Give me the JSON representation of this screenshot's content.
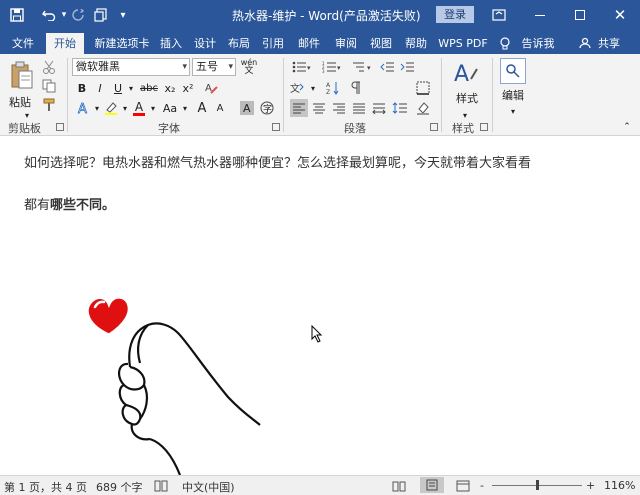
{
  "window": {
    "title": "热水器-维护  -  Word(产品激活失败)",
    "login_label": "登录",
    "minimize_icon": "minimize-icon",
    "restore_icon": "restore-icon",
    "close_icon": "close-icon"
  },
  "quick_access": [
    "save-icon",
    "undo-icon",
    "redo-icon",
    "touch-mode-icon",
    "customize-icon"
  ],
  "tabs": [
    {
      "label": "文件"
    },
    {
      "label": "开始"
    },
    {
      "label": "新建选项卡"
    },
    {
      "label": "插入"
    },
    {
      "label": "设计"
    },
    {
      "label": "布局"
    },
    {
      "label": "引用"
    },
    {
      "label": "邮件"
    },
    {
      "label": "审阅"
    },
    {
      "label": "视图"
    },
    {
      "label": "帮助"
    },
    {
      "label": "WPS PDF"
    }
  ],
  "tell_me": "告诉我",
  "share": "共享",
  "ribbon": {
    "clipboard": {
      "paste_label": "粘贴",
      "group_label": "剪贴板"
    },
    "font": {
      "font_name": "微软雅黑",
      "font_size": "五号",
      "wen_label": "wén",
      "bold": "B",
      "italic": "I",
      "underline": "U",
      "strike": "abc",
      "sub": "x₂",
      "sup": "x²",
      "aa_label": "Aa",
      "grow": "A",
      "shrink": "A",
      "group_label": "字体"
    },
    "paragraph": {
      "group_label": "段落"
    },
    "styles": {
      "label": "样式",
      "group_label": "样式"
    },
    "editing": {
      "label": "编辑"
    }
  },
  "document": {
    "para1": "如何选择呢？电热水器和燃气热水器哪种便宜？怎么选择最划算呢，今天就带着大家看看",
    "para2_prefix": "都有",
    "para2_bold": "哪些不同。",
    "heart_color": "#e01010"
  },
  "status": {
    "page": "第 1 页，共 4 页",
    "words": "689 个字",
    "language": "中文(中国)",
    "zoom": "116%",
    "zoom_minus": "-",
    "zoom_plus": "+"
  },
  "colors": {
    "brand": "#2b579a",
    "ribbon_bg": "#f3f3f3",
    "highlight_yellow": "#ffff00",
    "font_red": "#ff0000"
  }
}
